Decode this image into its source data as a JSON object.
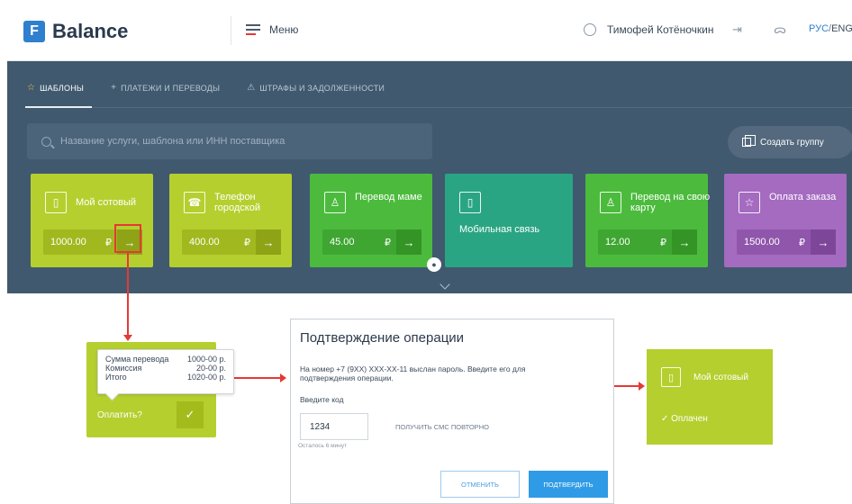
{
  "header": {
    "logo_letter": "F",
    "logo_text": "Balance",
    "menu_label": "Меню",
    "user_name": "Тимофей Котёночкин",
    "lang_active": "РУС",
    "lang_sep": "/",
    "lang_inactive": "ENG"
  },
  "tabs": [
    {
      "icon": "☆",
      "label": "ШАБЛОНЫ"
    },
    {
      "icon": "+",
      "label": "ПЛАТЕЖИ И ПЕРЕВОДЫ"
    },
    {
      "icon": "⚠",
      "label": "ШТРАФЫ И ЗАДОЛЖЕННОСТИ"
    }
  ],
  "search": {
    "placeholder": "Название услуги, шаблона или ИНН поставщика"
  },
  "create_group_label": "Создать группу",
  "cards": [
    {
      "title": "Мой сотовый",
      "amount": "1000.00",
      "currency": "₽",
      "color": "#b5cf2f",
      "icon": "mobile-icon"
    },
    {
      "title": "Телефон городской",
      "amount": "400.00",
      "currency": "₽",
      "color": "#b5cf2f",
      "icon": "phone-icon"
    },
    {
      "title": "Перевод маме",
      "amount": "45.00",
      "currency": "₽",
      "color": "#4cbb3d",
      "icon": "person-icon"
    },
    {
      "title": "Мобильная связь",
      "color": "#2aa583",
      "icon": "mobile-icon"
    },
    {
      "title": "Перевод на свою карту",
      "amount": "12.00",
      "currency": "₽",
      "color": "#4cbb3d",
      "icon": "person-transfer-icon"
    },
    {
      "title": "Оплата заказа",
      "amount": "1500.00",
      "currency": "₽",
      "color": "#a46bc0",
      "icon": "star-icon"
    }
  ],
  "go_arrow": "→",
  "mini_confirm": {
    "rows": [
      {
        "label": "Сумма перевода",
        "value": "1000-00 р."
      },
      {
        "label": "Комиссия",
        "value": "20-00 р."
      },
      {
        "label": "Итого",
        "value": "1020-00 р."
      }
    ],
    "pay_label": "Оплатить?",
    "check": "✓"
  },
  "dialog": {
    "title": "Подтверждение операции",
    "message": "На номер +7 (9XX) XXX-XX-11 выслан пароль. Введите его для подтверждения операции.",
    "code_label": "Введите код",
    "code_value": "1234",
    "resend": "ПОЛУЧИТЬ СМС ПОВТОРНО",
    "time_left": "Осталось 6 минут",
    "cancel": "ОТМЕНИТЬ",
    "confirm": "ПОДТВЕРДИТЬ"
  },
  "paid_card": {
    "title": "Мой сотовый",
    "status": "✓  Оплачен"
  },
  "colors": {
    "accent": "#2f7fcf",
    "panel": "#40596f",
    "highlight": "#e53935"
  }
}
